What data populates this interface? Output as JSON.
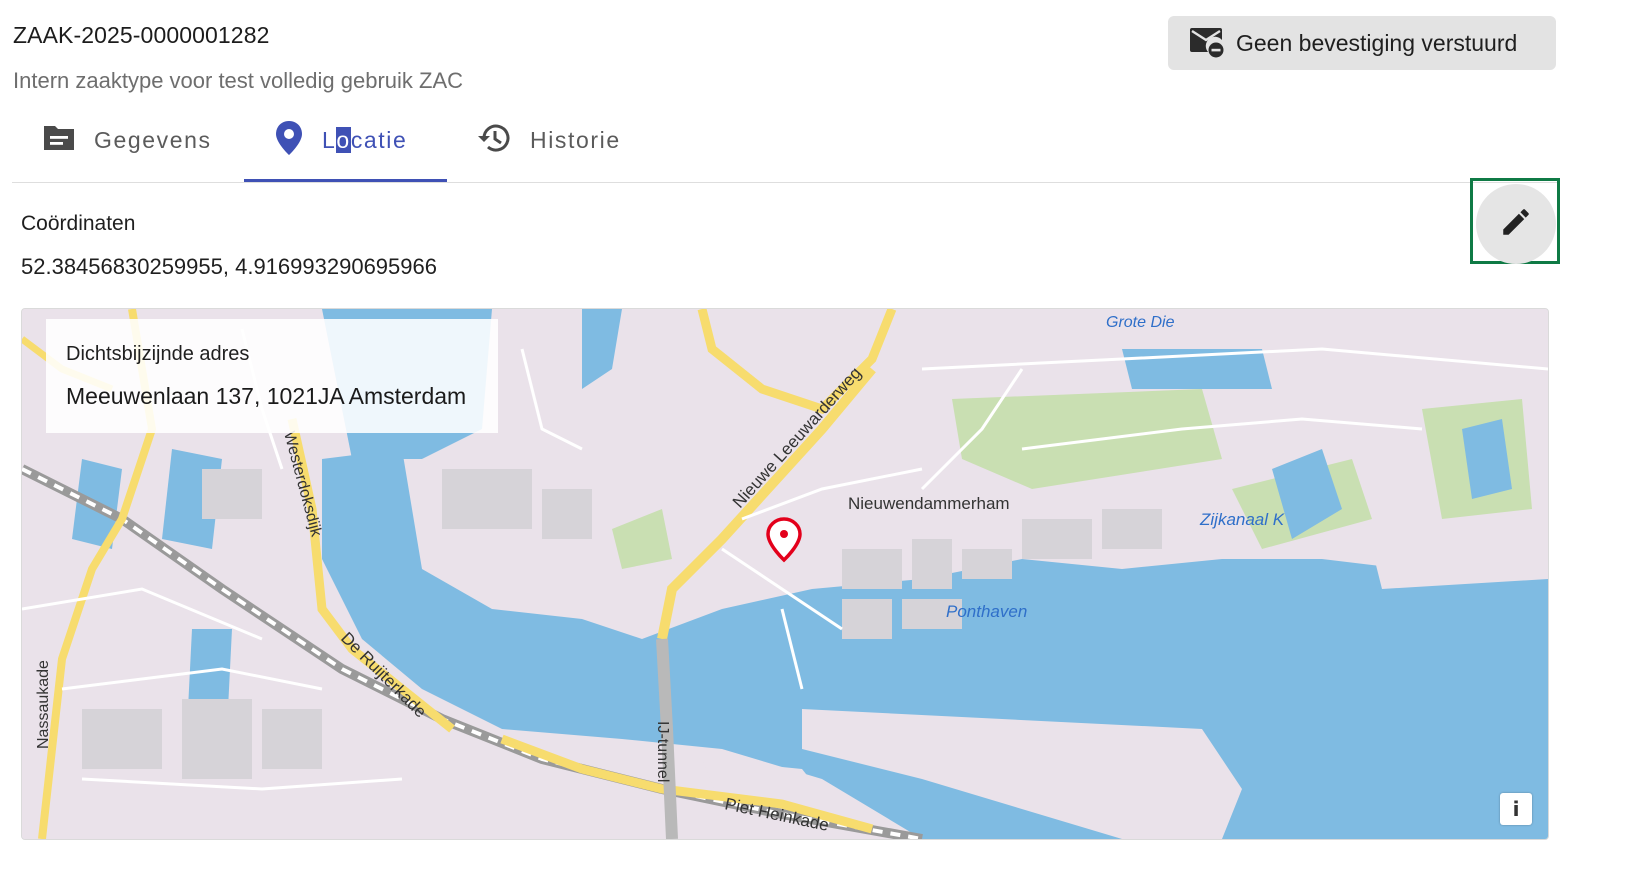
{
  "header": {
    "case_id": "ZAAK-2025-0000001282",
    "case_type": "Intern zaaktype voor test volledig gebruik ZAC",
    "confirm_button": {
      "label": "Geen bevestiging verstuurd",
      "icon": "mail-off-icon"
    }
  },
  "tabs": [
    {
      "label": "Gegevens",
      "icon": "description-icon",
      "active": false
    },
    {
      "label_parts": [
        "L",
        "o",
        "catie"
      ],
      "icon": "location-pin-icon",
      "active": true
    },
    {
      "label": "Historie",
      "icon": "history-icon",
      "active": false
    }
  ],
  "location": {
    "coordinates_label": "Coördinaten",
    "coordinates_value": "52.38456830259955, 4.916993290695966",
    "edit_button_icon": "pencil-icon"
  },
  "map": {
    "nearest_address_label": "Dichtsbijzijnde adres",
    "nearest_address": "Meeuwenlaan 137, 1021JA Amsterdam",
    "street_labels": {
      "nieuwe_leeuwarderweg": "Nieuwe Leeuwarderweg",
      "nieuwendammerham": "Nieuwendammerham",
      "zijkanaal": "Zijkanaal K",
      "ponthaven": "Ponthaven",
      "westerdoksdijk": "Westerdoksdijk",
      "de_ruijterkade": "De Ruijterkade",
      "ij_tunnel": "IJ-tunnel",
      "piet_heinkade": "Piet Heinkade",
      "grote_die": "Grote Die",
      "nassaukade": "Nassaukade"
    },
    "info_button": "i",
    "colors": {
      "water": "#7fbbe2",
      "land": "#eae2ea",
      "road": "#f7dc6e",
      "park": "#c9dfb2",
      "marker": "#e3001b"
    }
  }
}
